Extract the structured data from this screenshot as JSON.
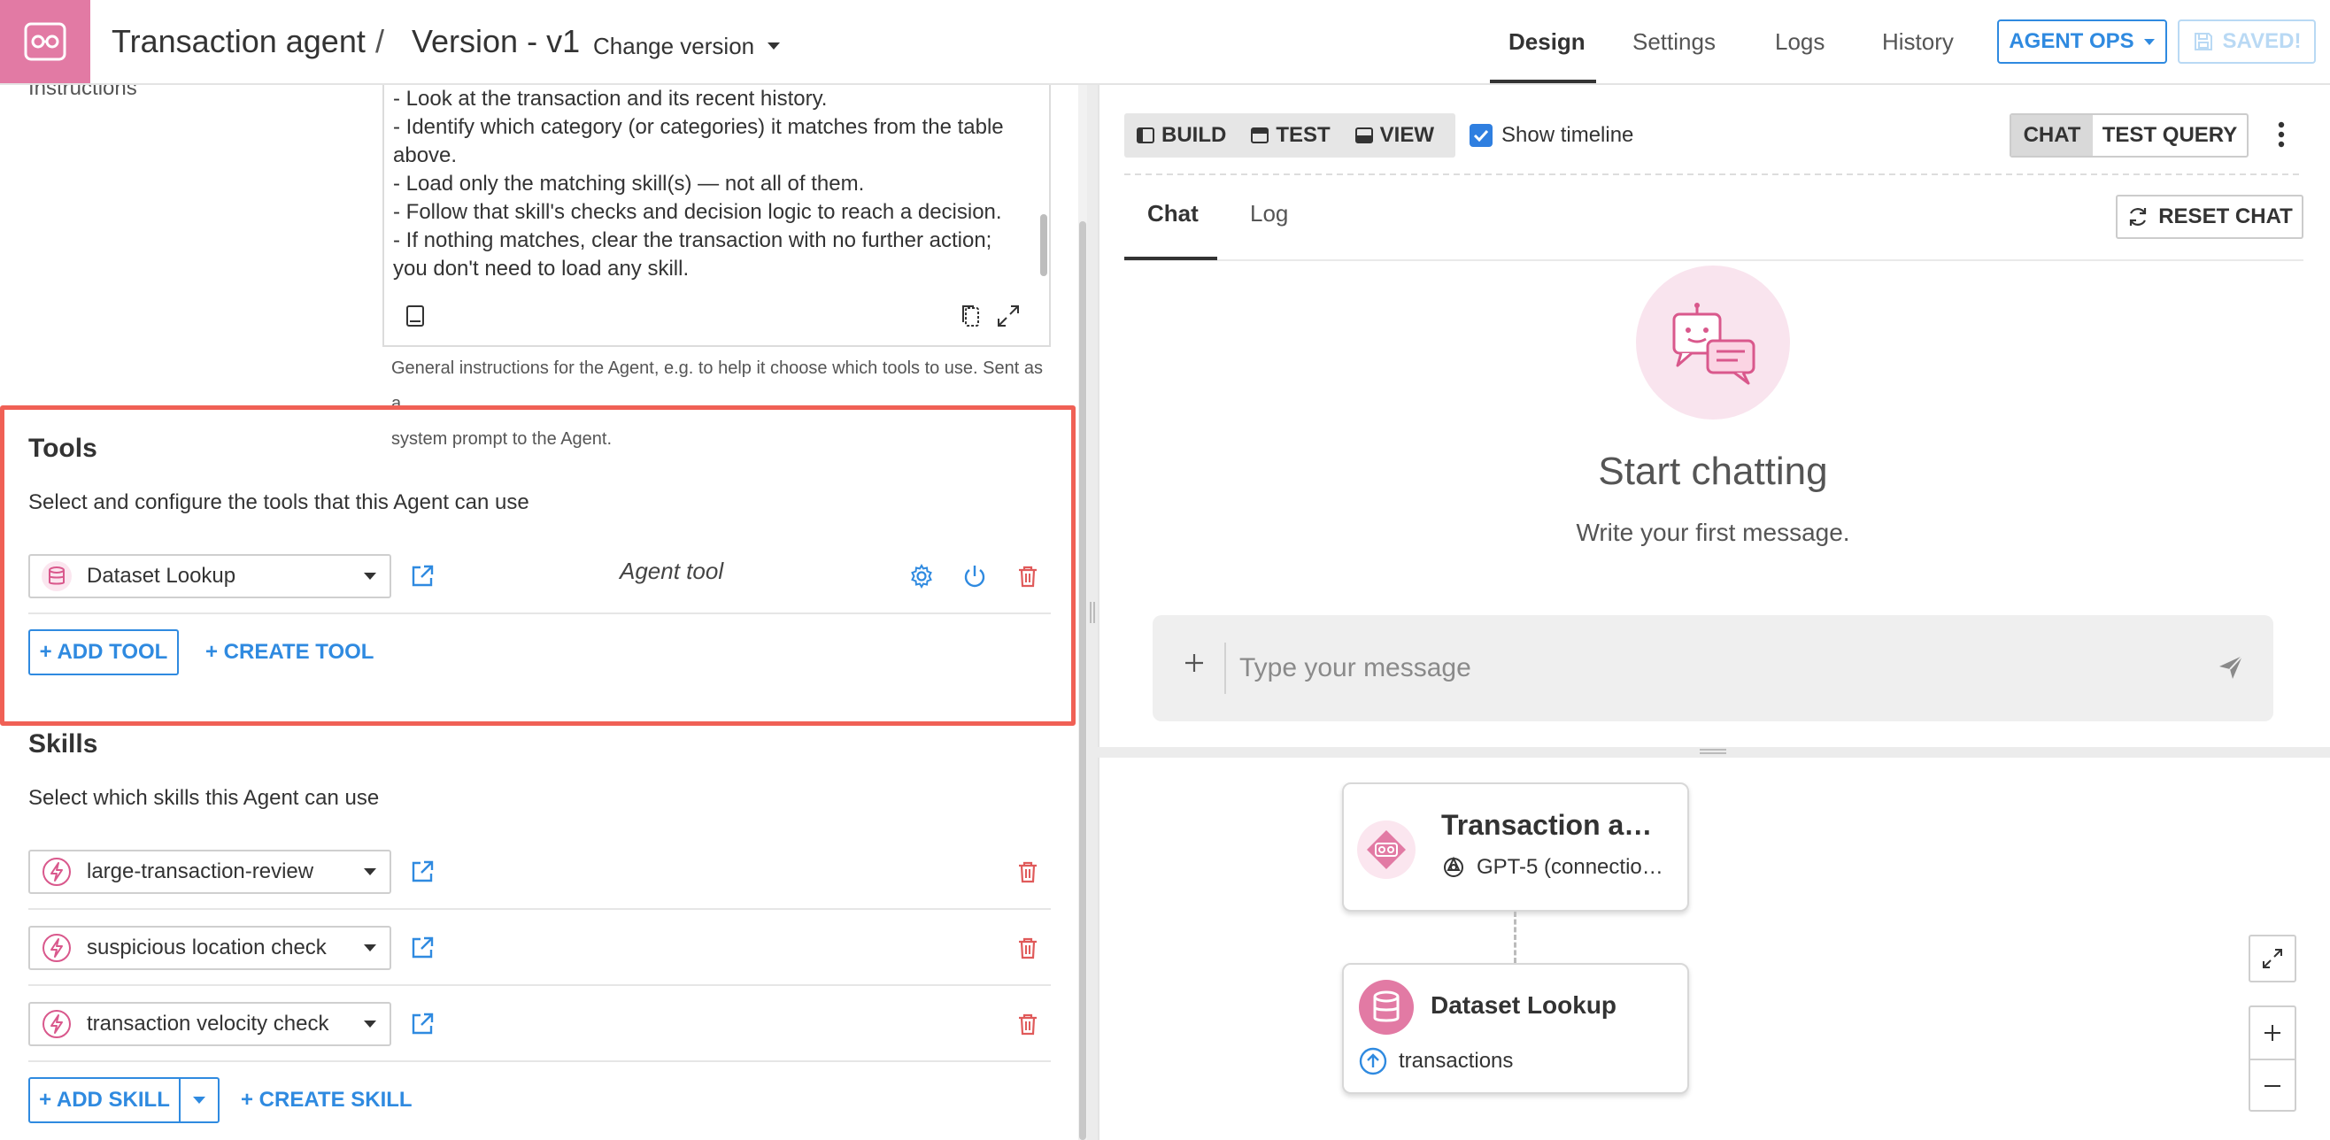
{
  "header": {
    "agent_name": "Transaction agent",
    "separator": "/",
    "version": "Version - v1",
    "change_version": "Change version",
    "tabs": [
      {
        "label": "Design"
      },
      {
        "label": "Settings"
      },
      {
        "label": "Logs"
      },
      {
        "label": "History"
      }
    ],
    "active_tab": "Design",
    "agent_ops": "AGENT OPS",
    "saved": "SAVED!"
  },
  "instructions": {
    "label": "Instructions",
    "lines": [
      "- Look at the transaction and its recent history.",
      "- Identify which category (or categories) it matches from the table",
      "above.",
      "- Load only the matching skill(s) — not all of them.",
      "- Follow that skill's checks and decision logic to reach a decision.",
      "- If nothing matches, clear the transaction with no further action;",
      "you don't need to load any skill."
    ],
    "help_line1": "General instructions for the Agent, e.g. to help it choose which tools to use. Sent as a",
    "help_line2": "system prompt to the Agent."
  },
  "tools": {
    "title": "Tools",
    "description": "Select and configure the tools that this Agent can use",
    "items": [
      {
        "label": "Dataset Lookup",
        "kind": "Agent tool"
      }
    ],
    "add_label": "+ ADD TOOL",
    "create_label": "+ CREATE TOOL"
  },
  "skills": {
    "title": "Skills",
    "description": "Select which skills this Agent can use",
    "items": [
      {
        "label": "large-transaction-review"
      },
      {
        "label": "suspicious location check"
      },
      {
        "label": "transaction velocity check"
      }
    ],
    "add_label": "+ ADD SKILL",
    "create_label": "+ CREATE SKILL"
  },
  "chat_panel": {
    "modes": [
      {
        "label": "BUILD"
      },
      {
        "label": "TEST"
      },
      {
        "label": "VIEW"
      }
    ],
    "show_timeline": "Show timeline",
    "show_timeline_checked": true,
    "toggle": [
      {
        "label": "CHAT"
      },
      {
        "label": "TEST QUERY"
      }
    ],
    "toggle_selected": "CHAT",
    "tabs": [
      {
        "label": "Chat"
      },
      {
        "label": "Log"
      }
    ],
    "active_tab": "Chat",
    "reset_chat": "RESET CHAT",
    "empty_title": "Start chatting",
    "empty_subtitle": "Write your first message.",
    "composer": {
      "value": "",
      "placeholder": "Type your message"
    }
  },
  "graph": {
    "agent_node": {
      "title": "Transaction a…",
      "model": "GPT-5 (connectio…"
    },
    "tool_node": {
      "title": "Dataset Lookup",
      "dataset": "transactions"
    }
  },
  "colors": {
    "accent_blue": "#2f8ae0",
    "brand_pink": "#e27aa4",
    "highlight_red": "#f06055",
    "delete_red": "#e05a5a"
  },
  "icons": {
    "logo": "agent-glasses-icon",
    "dataset": "database-icon",
    "skill": "lightning-icon",
    "open": "external-link-icon",
    "settings": "gear-icon",
    "power": "power-icon",
    "delete": "trash-icon"
  }
}
